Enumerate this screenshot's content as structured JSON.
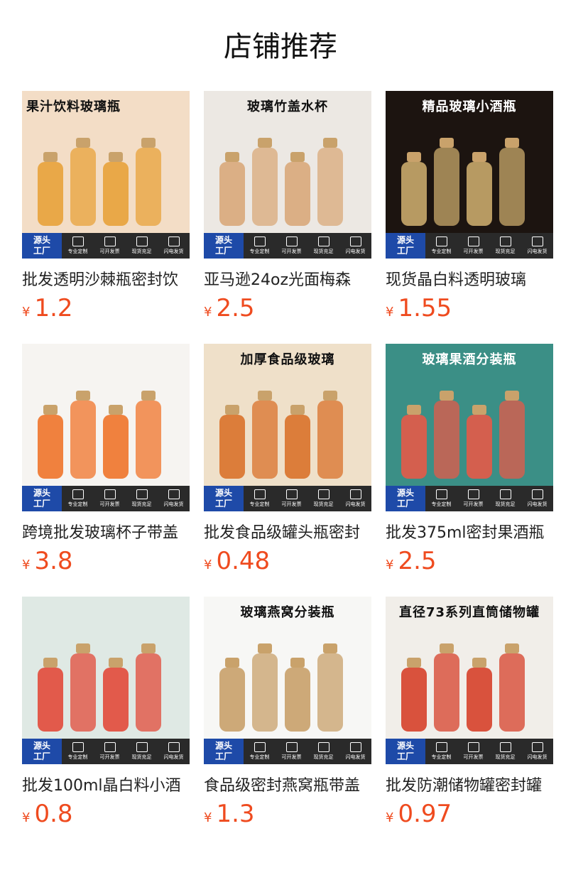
{
  "shop": {
    "title": "店铺推荐"
  },
  "badges": {
    "source_line1": "源头",
    "source_line2": "工厂",
    "features": [
      "专业定制",
      "可开发票",
      "现货充足",
      "闪电发货"
    ]
  },
  "products": [
    {
      "image_caption": "果汁饮料玻璃瓶",
      "name": "批发透明沙棘瓶密封饮",
      "currency": "¥",
      "price": "1.2",
      "bg": "#f3ddc6",
      "accent": "#e8a23a"
    },
    {
      "image_caption": "玻璃竹盖水杯",
      "name": "亚马逊24oz光面梅森",
      "currency": "¥",
      "price": "2.5",
      "bg": "#ece8e3",
      "accent": "#d9a97a"
    },
    {
      "image_caption": "精品玻璃小酒瓶",
      "name": "现货晶白料透明玻璃",
      "currency": "¥",
      "price": "1.55",
      "bg": "#1c1410",
      "accent": "#c9a96b"
    },
    {
      "image_caption": "",
      "name": "跨境批发玻璃杯子带盖",
      "currency": "¥",
      "price": "3.8",
      "bg": "#f6f4f1",
      "accent": "#f0742a"
    },
    {
      "image_caption": "加厚食品级玻璃",
      "name": "批发食品级罐头瓶密封",
      "currency": "¥",
      "price": "0.48",
      "bg": "#efe0c9",
      "accent": "#d9722a"
    },
    {
      "image_caption": "玻璃果酒分装瓶",
      "name": "批发375ml密封果酒瓶",
      "currency": "¥",
      "price": "2.5",
      "bg": "#3b8f86",
      "accent": "#e55a48"
    },
    {
      "image_caption": "",
      "name": "批发100ml晶白料小酒",
      "currency": "¥",
      "price": "0.8",
      "bg": "#dfe9e4",
      "accent": "#e24a3a"
    },
    {
      "image_caption": "玻璃燕窝分装瓶",
      "name": "食品级密封燕窝瓶带盖",
      "currency": "¥",
      "price": "1.3",
      "bg": "#f7f7f5",
      "accent": "#c8a06a"
    },
    {
      "image_caption": "直径73系列直筒储物罐",
      "name": "批发防潮储物罐密封罐",
      "currency": "¥",
      "price": "0.97",
      "bg": "#f1eee9",
      "accent": "#d6402a"
    }
  ]
}
